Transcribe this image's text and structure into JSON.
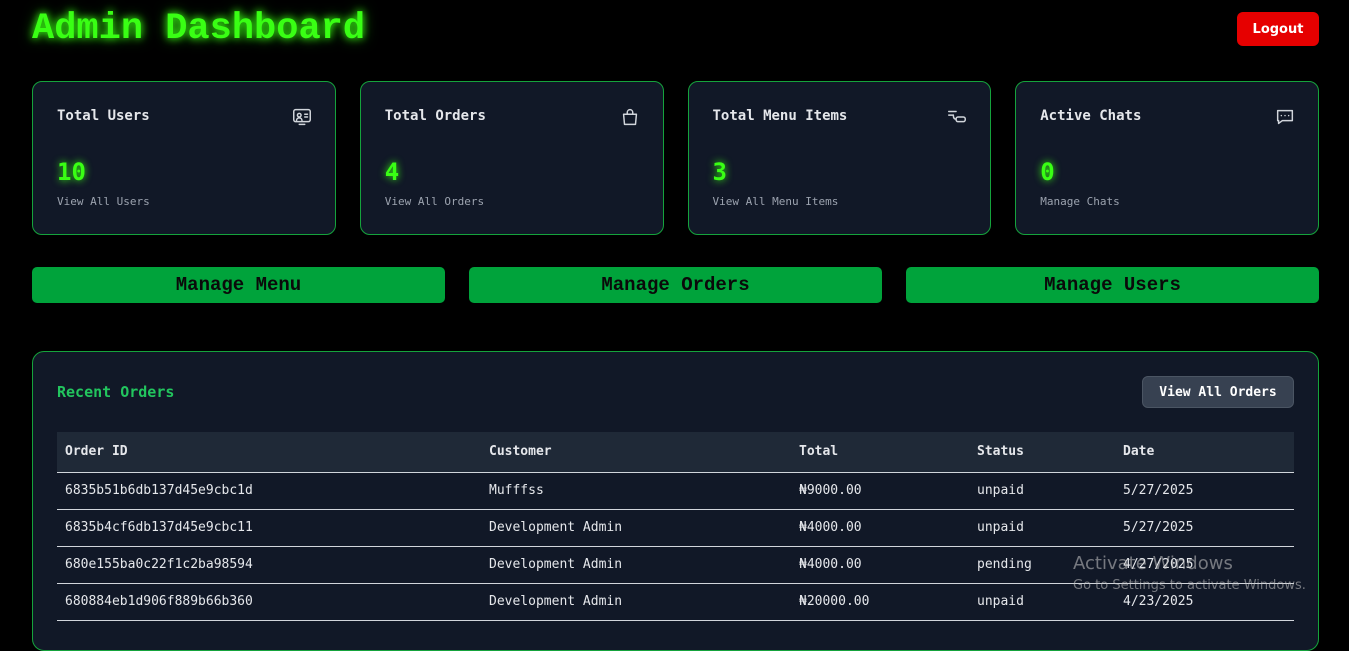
{
  "header": {
    "title": "Admin Dashboard",
    "logout_label": "Logout"
  },
  "cards": [
    {
      "label": "Total Users",
      "value": "10",
      "link": "View All Users",
      "icon": "users-screen-icon"
    },
    {
      "label": "Total Orders",
      "value": "4",
      "link": "View All Orders",
      "icon": "shopping-bag-icon"
    },
    {
      "label": "Total Menu Items",
      "value": "3",
      "link": "View All Menu Items",
      "icon": "menu-items-icon"
    },
    {
      "label": "Active Chats",
      "value": "0",
      "link": "Manage Chats",
      "icon": "chat-icon"
    }
  ],
  "actions": {
    "manage_menu": "Manage Menu",
    "manage_orders": "Manage Orders",
    "manage_users": "Manage Users"
  },
  "recent_orders": {
    "title": "Recent Orders",
    "view_all_label": "View All Orders",
    "columns": [
      "Order ID",
      "Customer",
      "Total",
      "Status",
      "Date"
    ],
    "rows": [
      {
        "id": "6835b51b6db137d45e9cbc1d",
        "customer": "Mufffss",
        "total": "₦9000.00",
        "status": "unpaid",
        "date": "5/27/2025"
      },
      {
        "id": "6835b4cf6db137d45e9cbc11",
        "customer": "Development Admin",
        "total": "₦4000.00",
        "status": "unpaid",
        "date": "5/27/2025"
      },
      {
        "id": "680e155ba0c22f1c2ba98594",
        "customer": "Development Admin",
        "total": "₦4000.00",
        "status": "pending",
        "date": "4/27/2025"
      },
      {
        "id": "680884eb1d906f889b66b360",
        "customer": "Development Admin",
        "total": "₦20000.00",
        "status": "unpaid",
        "date": "4/23/2025"
      }
    ]
  },
  "watermark": {
    "line1": "Activate Windows",
    "line2": "Go to Settings to activate Windows."
  },
  "colors": {
    "neon_green": "#39ff14",
    "button_green": "#00a33b",
    "card_bg": "#111827",
    "logout_red": "#e60000"
  }
}
